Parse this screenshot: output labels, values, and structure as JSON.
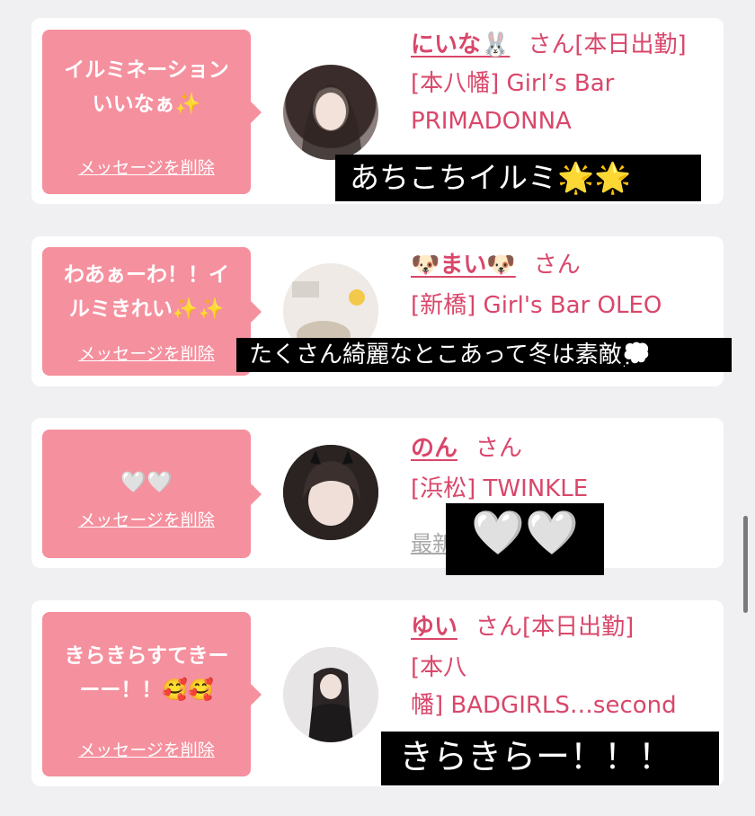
{
  "colors": {
    "accent": "#d9476a",
    "bubble": "#f5909e"
  },
  "messages": [
    {
      "bubble_lines": [
        "イルミネーション",
        "いいなぁ✨"
      ],
      "delete_label": "メッセージを削除",
      "cast_name": "にいな🐰",
      "honorific": "さん",
      "status": "[本日出勤]",
      "shop_lines": [
        "[本八幡] Girl’s Bar",
        "PRIMADONNA"
      ],
      "caption": "あちこちイルミ🌟🌟"
    },
    {
      "bubble_lines": [
        "わあぁーわ！！イ",
        "ルミきれい✨✨"
      ],
      "delete_label": "メッセージを削除",
      "cast_name": "🐶まい🐶",
      "honorific": "さん",
      "status": "",
      "shop_lines": [
        "[新橋] Girl's Bar OLEO"
      ],
      "caption": "たくさん綺麗なとこあって冬は素敵💭"
    },
    {
      "bubble_lines": [
        "🤍🤍"
      ],
      "delete_label": "メッセージを削除",
      "cast_name": "のん",
      "honorific": "さん",
      "status": "",
      "shop_lines": [
        "[浜松] TWINKLE"
      ],
      "latest_link": "最新の投稿を見る",
      "caption": "🤍🤍"
    },
    {
      "bubble_lines": [
        "きらきらすてきー",
        "ーー！！🥰🥰"
      ],
      "delete_label": "メッセージを削除",
      "cast_name": "ゆい",
      "honorific": "さん",
      "status": "[本日出勤]",
      "shop_lines": [
        "[本八",
        "幡] BADGIRLS…second"
      ],
      "caption": "きらきらー！！！"
    }
  ]
}
